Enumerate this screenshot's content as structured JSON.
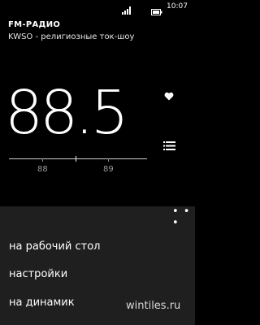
{
  "status_bar": {
    "time": "10:07",
    "signal_icon": "signal-bars-icon",
    "battery_icon": "battery-icon"
  },
  "header": {
    "app_title": "FM-РАДИО",
    "station_name": "KWSO - религиозные ток-шоу"
  },
  "tuner": {
    "frequency": "88.5",
    "tick_labels": [
      "88",
      "89"
    ]
  },
  "actions": {
    "favorite_icon": "heart-icon",
    "list_icon": "station-list-icon"
  },
  "app_bar": {
    "more_icon": "more-dots-icon",
    "more_label": "• • •",
    "items": [
      "на рабочий стол",
      "настройки",
      "на динамик"
    ]
  },
  "watermark": "wintiles.ru"
}
